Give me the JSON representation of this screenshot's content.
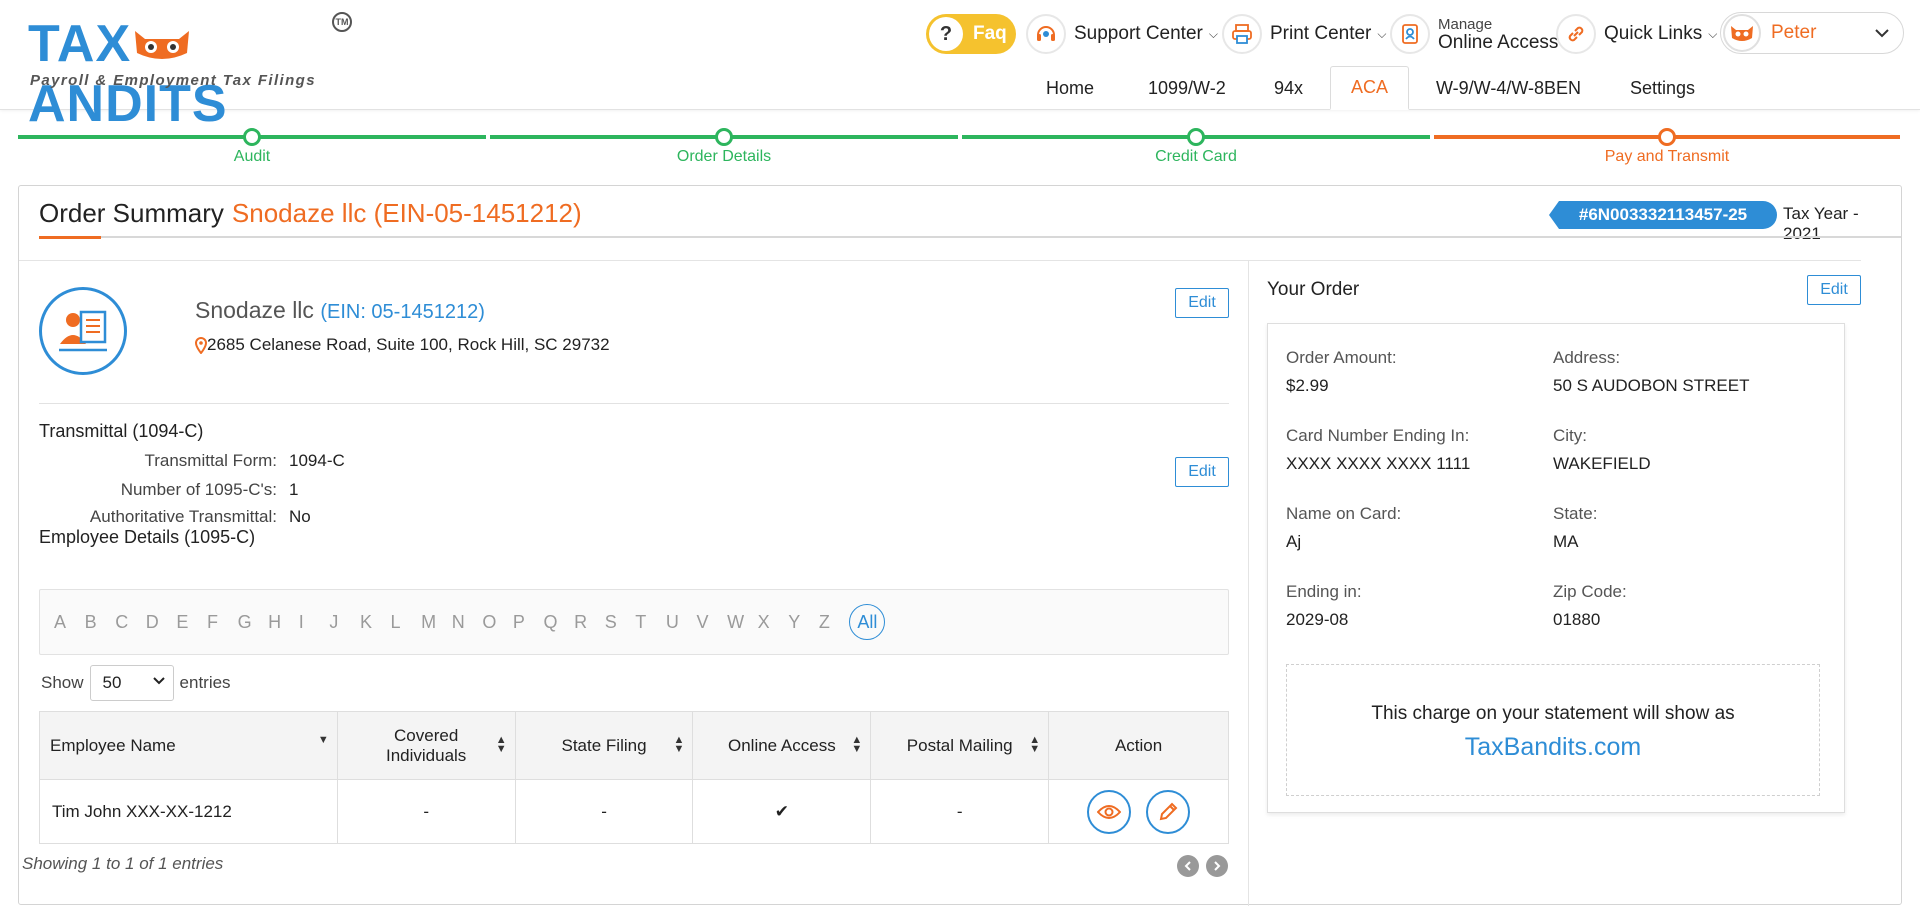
{
  "brand": {
    "name": "TAXBANDITS",
    "tagline": "Payroll & Employment Tax Filings",
    "tm": "TM"
  },
  "topnav": {
    "faq": "Faq",
    "support": "Support Center",
    "print": "Print Center",
    "manage_small": "Manage",
    "manage_large": "Online Access",
    "quick_links": "Quick Links",
    "user": "Peter"
  },
  "tabs": [
    {
      "label": "Home"
    },
    {
      "label": "1099/W-2"
    },
    {
      "label": "94x"
    },
    {
      "label": "ACA"
    },
    {
      "label": "W-9/W-4/W-8BEN"
    },
    {
      "label": "Settings"
    }
  ],
  "steps": [
    {
      "label": "Audit"
    },
    {
      "label": "Order Details"
    },
    {
      "label": "Credit Card"
    },
    {
      "label": "Pay and Transmit"
    }
  ],
  "summary": {
    "title": "Order Summary",
    "company_heading": "Snodaze llc (EIN-05-1451212)",
    "order_number": "#6N003332113457-25",
    "tax_year": "Tax Year - 2021"
  },
  "company": {
    "name": "Snodaze llc",
    "ein": "(EIN: 05-1451212)",
    "address": "2685 Celanese Road, Suite 100, Rock Hill, SC 29732",
    "edit": "Edit"
  },
  "transmittal": {
    "title": "Transmittal (1094-C)",
    "edit": "Edit",
    "rows": [
      {
        "k": "Transmittal Form:",
        "v": "1094-C"
      },
      {
        "k": "Number of 1095-C's:",
        "v": "1"
      },
      {
        "k": "Authoritative Transmittal:",
        "v": "No"
      }
    ]
  },
  "employees": {
    "title": "Employee Details (1095-C)",
    "letters": [
      "A",
      "B",
      "C",
      "D",
      "E",
      "F",
      "G",
      "H",
      "I",
      "J",
      "K",
      "L",
      "M",
      "N",
      "O",
      "P",
      "Q",
      "R",
      "S",
      "T",
      "U",
      "V",
      "W",
      "X",
      "Y",
      "Z"
    ],
    "all": "All",
    "show_label": "Show",
    "show_value": "50",
    "entries_label": "entries",
    "columns": [
      "Employee Name",
      "Covered Individuals",
      "State Filing",
      "Online Access",
      "Postal Mailing",
      "Action"
    ],
    "rows": [
      {
        "name": "Tim John XXX-XX-1212",
        "covered": "-",
        "state": "-",
        "online": "✔",
        "postal": "-"
      }
    ],
    "showing": "Showing 1 to 1 of 1 entries"
  },
  "your_order": {
    "title": "Your Order",
    "edit": "Edit",
    "fields": {
      "order_amount_label": "Order Amount:",
      "order_amount": "$2.99",
      "address_label": "Address:",
      "address": "50 S AUDOBON STREET",
      "card_label": "Card Number Ending In:",
      "card": "XXXX XXXX XXXX 1111",
      "city_label": "City:",
      "city": "WAKEFIELD",
      "name_label": "Name on Card:",
      "name": "Aj",
      "state_label": "State:",
      "state": "MA",
      "ending_label": "Ending in:",
      "ending": "2029-08",
      "zip_label": "Zip Code:",
      "zip": "01880"
    },
    "charge_line1": "This charge on your statement will show as",
    "charge_line2": "TaxBandits.com"
  },
  "colors": {
    "brand_blue": "#2e8dd6",
    "brand_orange": "#ef6c22",
    "step_green": "#2db55d",
    "faq_yellow": "#f5c22e"
  }
}
